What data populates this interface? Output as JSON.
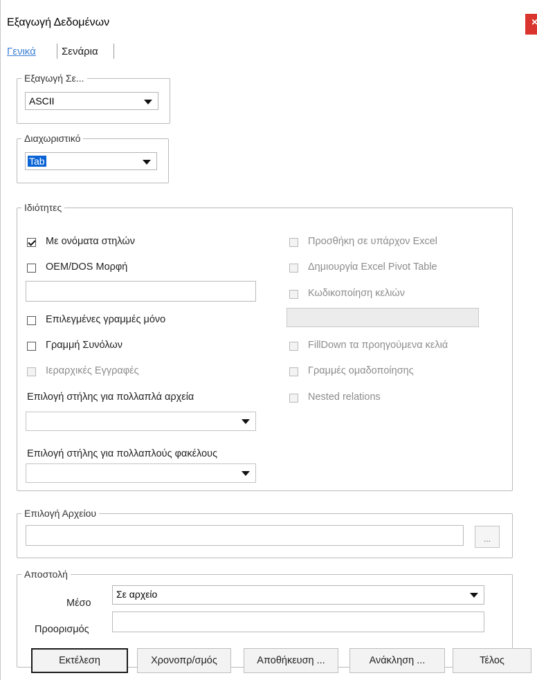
{
  "window": {
    "title": "Εξαγωγή Δεδομένων",
    "close_label": "×"
  },
  "tabs": [
    {
      "label": "Γενικά",
      "active": true
    },
    {
      "label": "Σενάρια",
      "active": false
    }
  ],
  "export_to": {
    "legend": "Εξαγωγή Σε...",
    "selected": "ASCII"
  },
  "delimiter": {
    "legend": "Διαχωριστικό",
    "selected": "Tab"
  },
  "properties": {
    "legend": "Ιδιότητες",
    "left": [
      {
        "label": "Με ονόματα στηλών",
        "checked": true,
        "enabled": true
      },
      {
        "label": "OEM/DOS Μορφή",
        "checked": false,
        "enabled": true
      },
      {
        "label": "Επιλεγμένες γραμμές μόνο",
        "checked": false,
        "enabled": true
      },
      {
        "label": "Γραμμή Συνόλων",
        "checked": false,
        "enabled": true
      },
      {
        "label": "Ιεραρχικές Εγγραφές",
        "checked": false,
        "enabled": false
      }
    ],
    "multi_files_label": "Επιλογή στήλης για πολλαπλά αρχεία",
    "multi_folders_label": "Επιλογή στήλης για πολλαπλούς φακέλους",
    "right": [
      {
        "label": "Προσθήκη σε υπάρχον Excel",
        "checked": false,
        "enabled": false
      },
      {
        "label": "Δημιουργία Excel Pivot Table",
        "checked": false,
        "enabled": false
      },
      {
        "label": "Κωδικοποίηση κελιών",
        "checked": false,
        "enabled": false
      },
      {
        "label": "FillDown τα προηγούμενα κελιά",
        "checked": false,
        "enabled": false
      },
      {
        "label": "Γραμμές ομαδοποίησης",
        "checked": false,
        "enabled": false
      },
      {
        "label": "Nested relations",
        "checked": false,
        "enabled": false
      }
    ]
  },
  "file_select": {
    "legend": "Επιλογή Αρχείου",
    "browse_label": "..."
  },
  "send": {
    "legend": "Αποστολή",
    "medium_label": "Μέσο",
    "medium_value": "Σε αρχείο",
    "destination_label": "Προορισμός"
  },
  "buttons": {
    "execute": "Εκτέλεση",
    "schedule": "Χρονοπρ/σμός",
    "save": "Αποθήκευση ...",
    "recall": "Ανάκληση ...",
    "end": "Τέλος"
  }
}
